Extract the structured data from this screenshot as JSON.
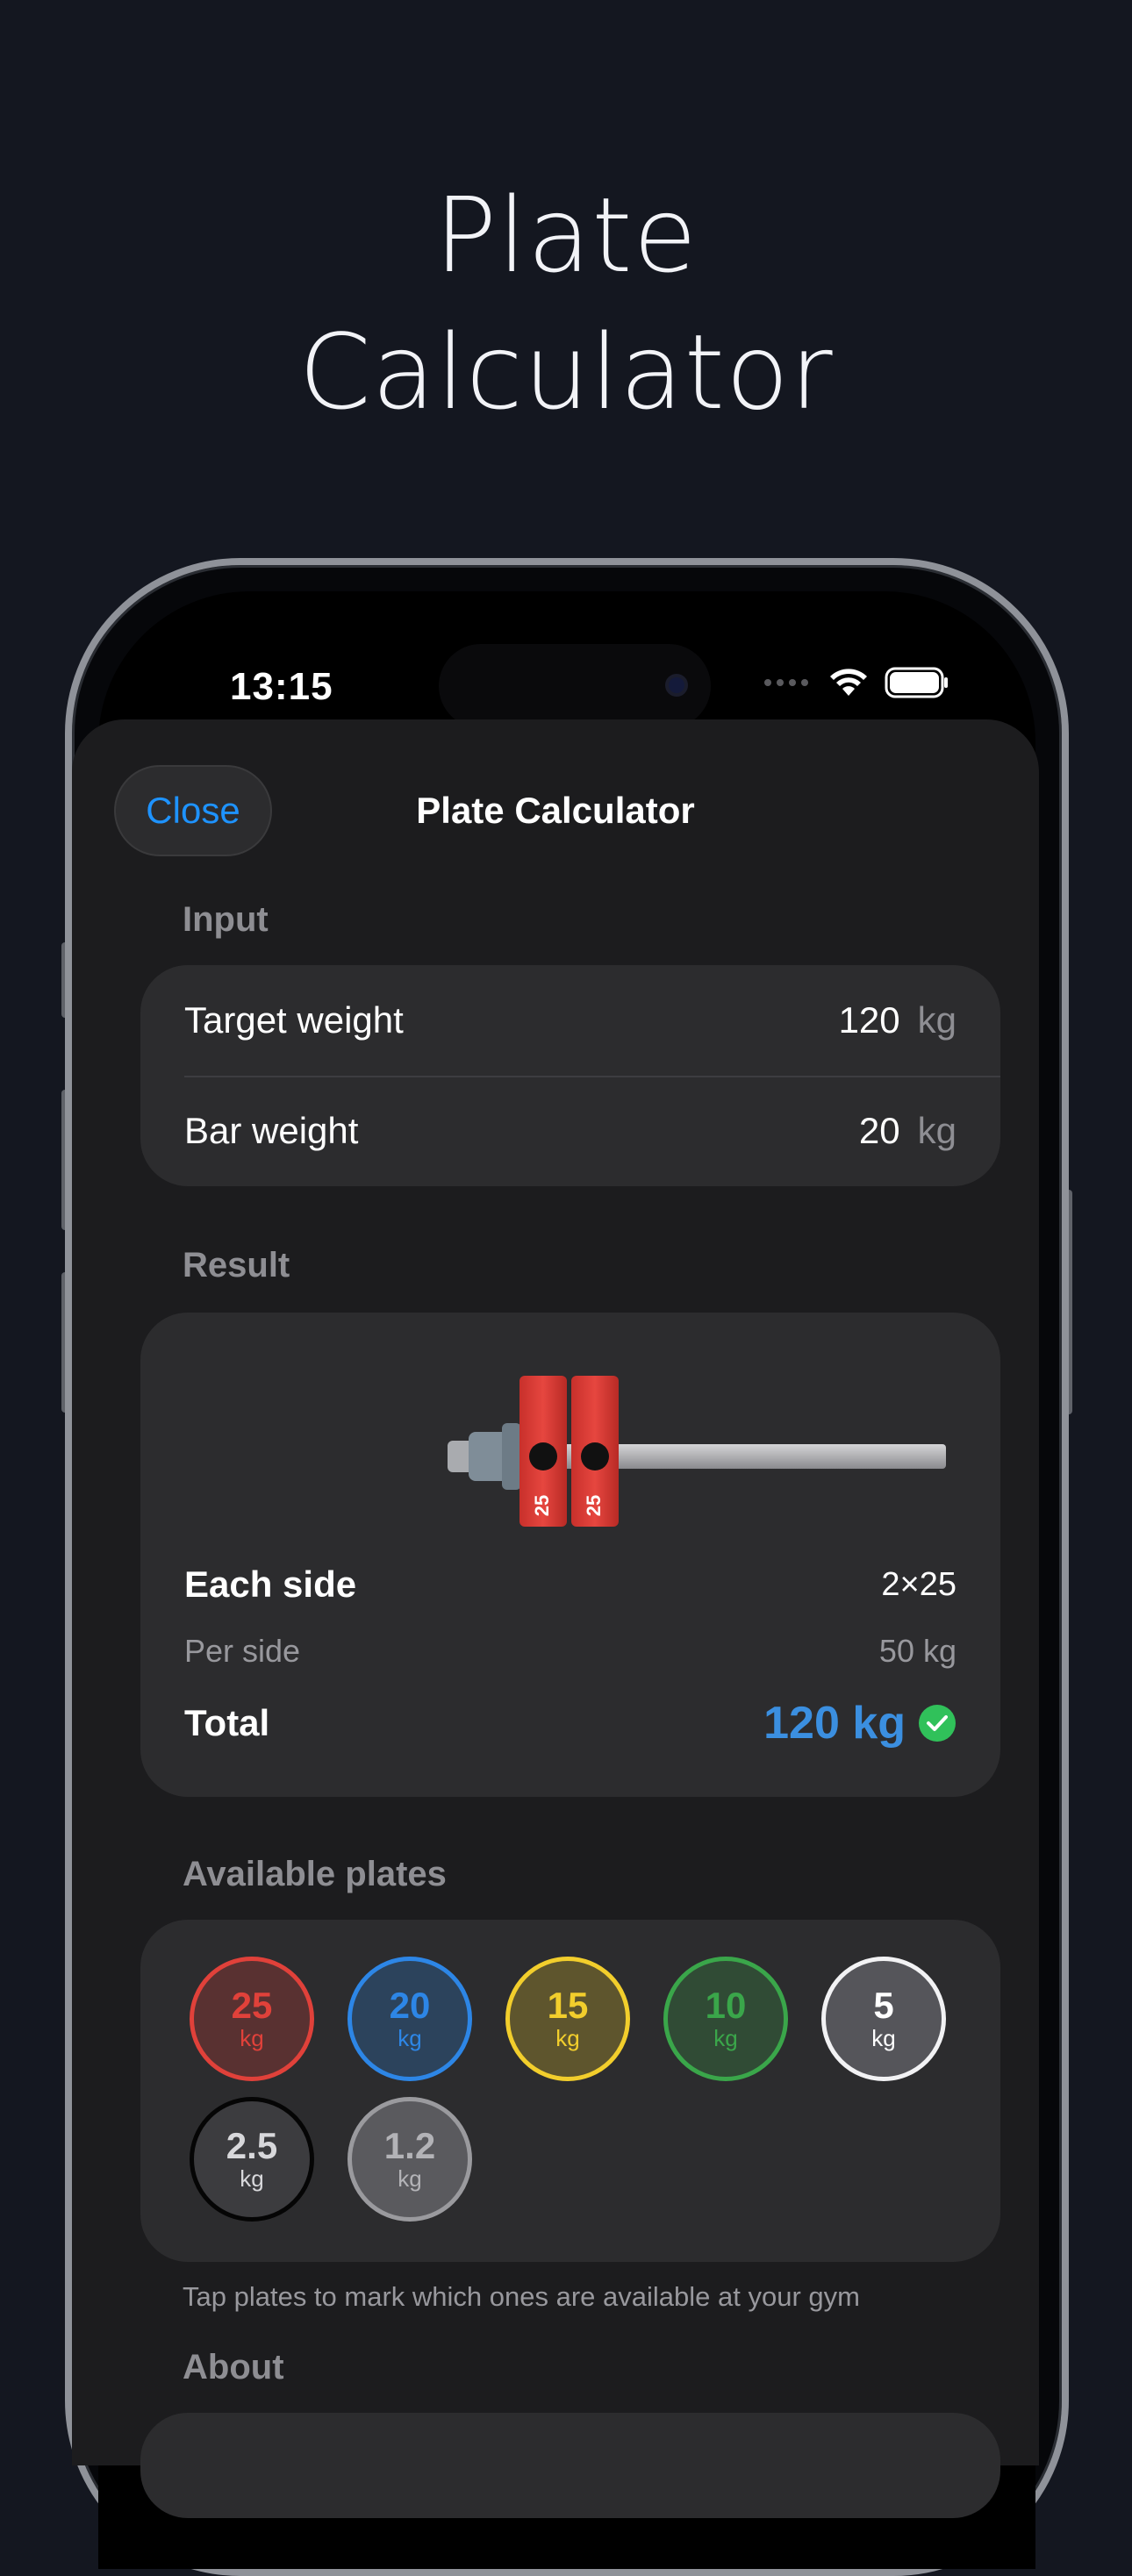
{
  "hero": {
    "line1": "Plate",
    "line2": "Calculator"
  },
  "status_bar": {
    "time": "13:15"
  },
  "nav": {
    "close_label": "Close",
    "title": "Plate Calculator"
  },
  "input": {
    "section": "Input",
    "target_label": "Target weight",
    "target_value": "120",
    "target_unit": "kg",
    "bar_label": "Bar weight",
    "bar_value": "20",
    "bar_unit": "kg"
  },
  "result": {
    "section": "Result",
    "bar_plates": [
      "25",
      "25"
    ],
    "each_side_label": "Each side",
    "each_side_value": "2×25",
    "per_side_label": "Per side",
    "per_side_value": "50 kg",
    "total_label": "Total",
    "total_value": "120 kg"
  },
  "plates": {
    "section": "Available plates",
    "items": [
      {
        "weight": "25",
        "unit": "kg",
        "color": "#e0413a",
        "available": true
      },
      {
        "weight": "20",
        "unit": "kg",
        "color": "#2d86e6",
        "available": true
      },
      {
        "weight": "15",
        "unit": "kg",
        "color": "#f2ce2c",
        "available": true
      },
      {
        "weight": "10",
        "unit": "kg",
        "color": "#3aa64a",
        "available": true
      },
      {
        "weight": "5",
        "unit": "kg",
        "color": "#e6e6e9",
        "available": true
      },
      {
        "weight": "2.5",
        "unit": "kg",
        "color": "#0b0b0c",
        "available": true
      },
      {
        "weight": "1.2",
        "unit": "kg",
        "color": "#9a9a9e",
        "available": true
      }
    ],
    "hint": "Tap plates to mark which ones are available at your gym"
  },
  "about": {
    "section": "About"
  }
}
